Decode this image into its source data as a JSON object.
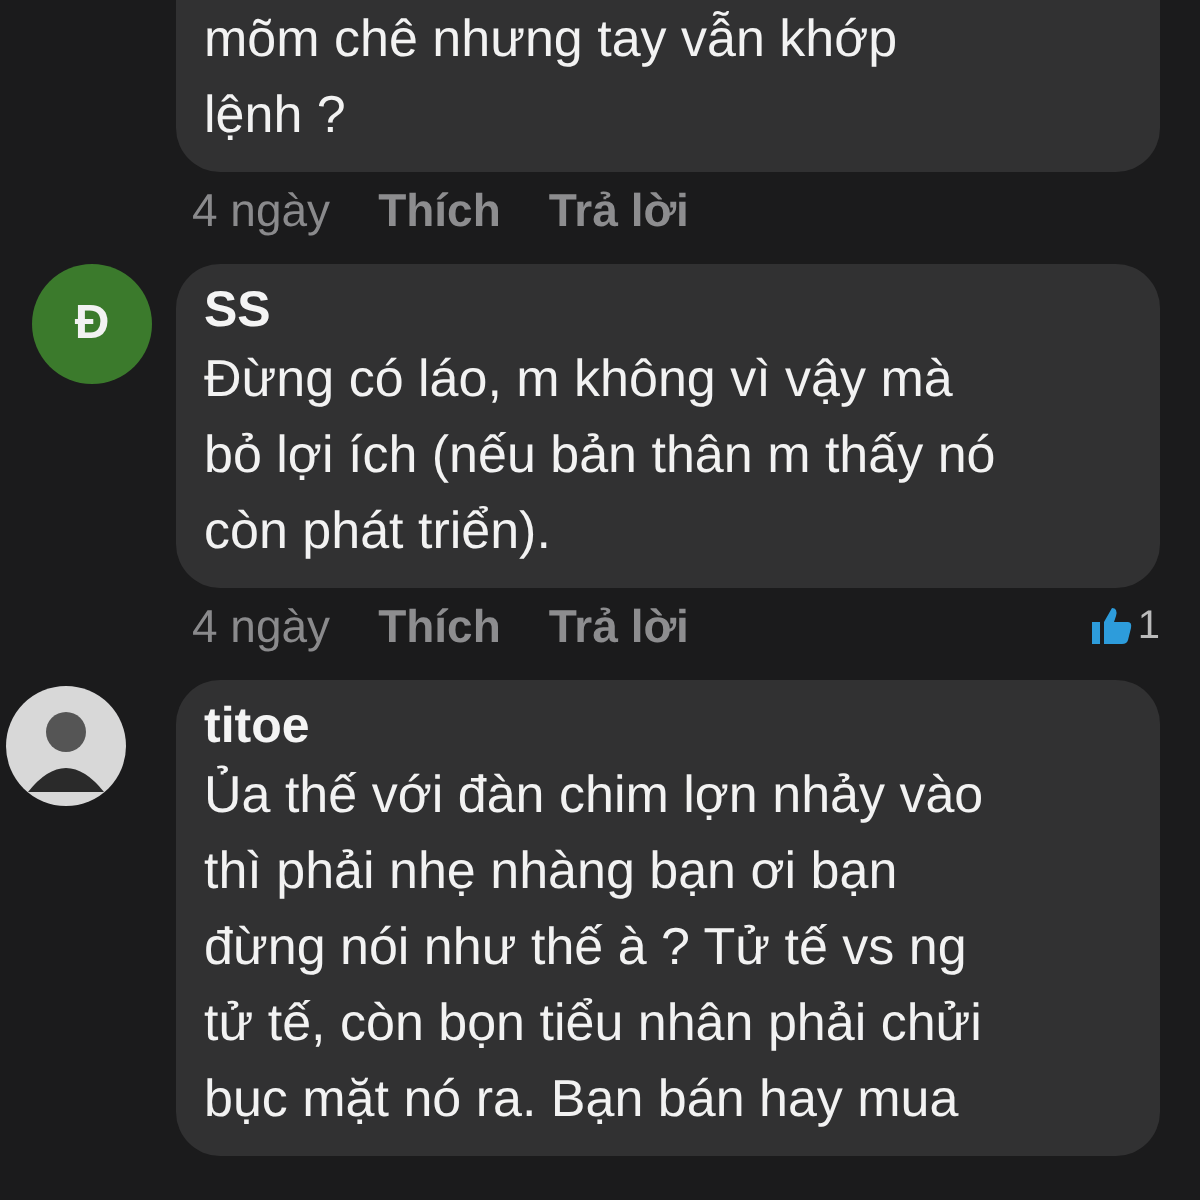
{
  "comments": [
    {
      "lines": [
        "mõm chê nhưng tay vẫn khớp",
        "lệnh ?"
      ],
      "time": "4 ngày",
      "like": "Thích",
      "reply": "Trả lời"
    },
    {
      "author": "SS",
      "avatar": {
        "kind": "initial",
        "letter": "Đ",
        "color": "#3b7a2c"
      },
      "lines": [
        "Đừng có láo, m không vì vậy mà",
        "bỏ lợi ích (nếu bản thân m thấy nó",
        "còn phát triển)."
      ],
      "time": "4 ngày",
      "like": "Thích",
      "reply": "Trả lời",
      "reactions": "1"
    },
    {
      "author": "titoe",
      "avatar": {
        "kind": "photo"
      },
      "lines": [
        "Ủa thế với đàn chim lợn nhảy vào",
        "thì phải nhẹ nhàng bạn ơi bạn",
        "đừng nói như thế à ? Tử tế vs ng",
        "tử tế, còn bọn tiểu nhân phải chửi",
        "bục mặt nó ra. Bạn bán hay mua"
      ]
    }
  ]
}
